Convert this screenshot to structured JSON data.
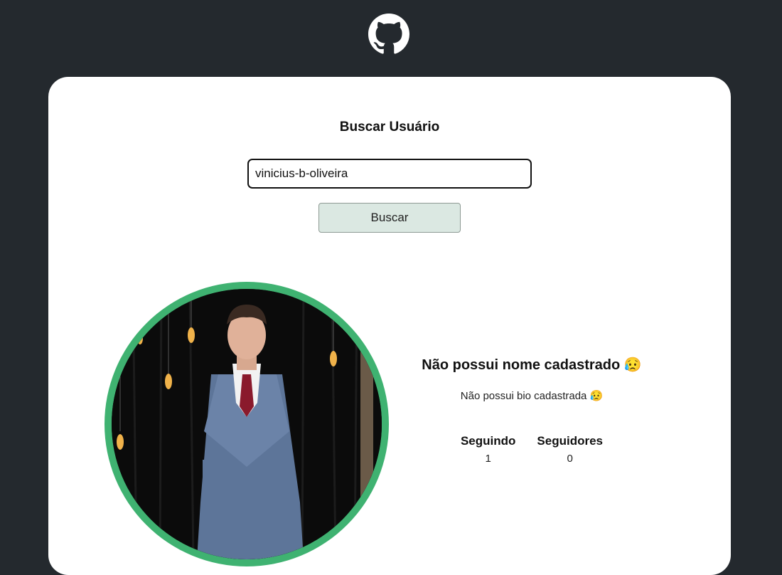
{
  "header": {
    "logo_icon": "github-octocat-icon"
  },
  "search": {
    "title": "Buscar Usuário",
    "input_value": "vinicius-b-oliveira",
    "button_label": "Buscar"
  },
  "profile": {
    "avatar_icon": "user-avatar-photo",
    "name": "Não possui nome cadastrado 😥",
    "bio": "Não possui bio cadastrada 😥",
    "following_label": "Seguindo",
    "following_count": "1",
    "followers_label": "Seguidores",
    "followers_count": "0"
  },
  "colors": {
    "page_background": "#24292e",
    "card_background": "#ffffff",
    "avatar_ring": "#3fb271",
    "button_background": "#dbe8e2"
  }
}
